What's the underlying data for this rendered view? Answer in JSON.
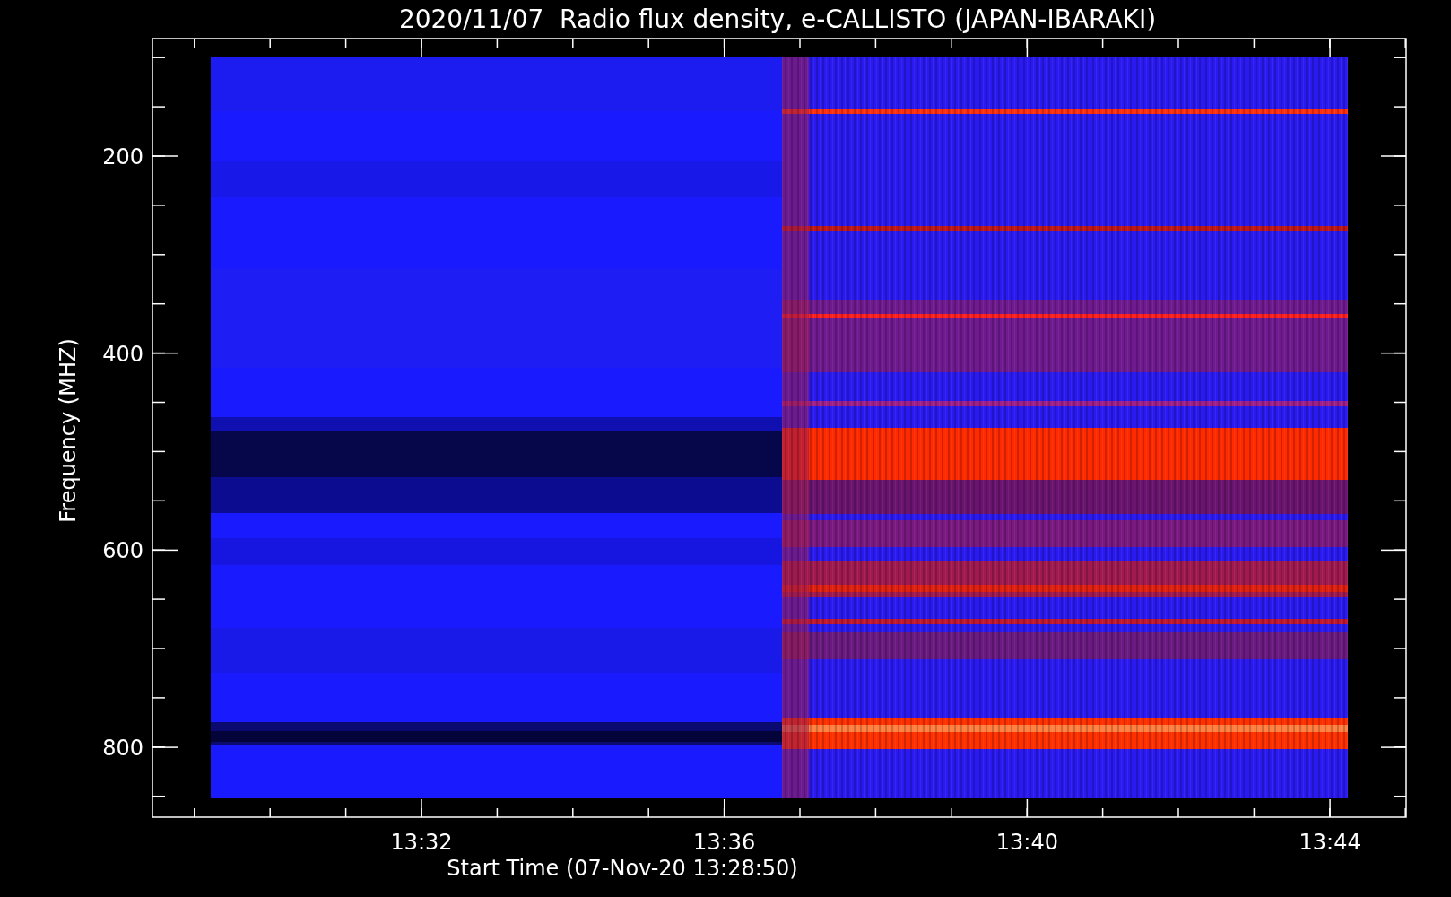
{
  "title": "2020/11/07  Radio flux density, e-CALLISTO (JAPAN-IBARAKI)",
  "x_axis": {
    "label": "Start Time (07-Nov-20 13:28:50)",
    "ticks": [
      "13:32",
      "13:36",
      "13:40",
      "13:44"
    ]
  },
  "y_axis": {
    "label": "Frequency (MHZ)",
    "ticks": [
      "200",
      "400",
      "600",
      "800"
    ]
  }
}
